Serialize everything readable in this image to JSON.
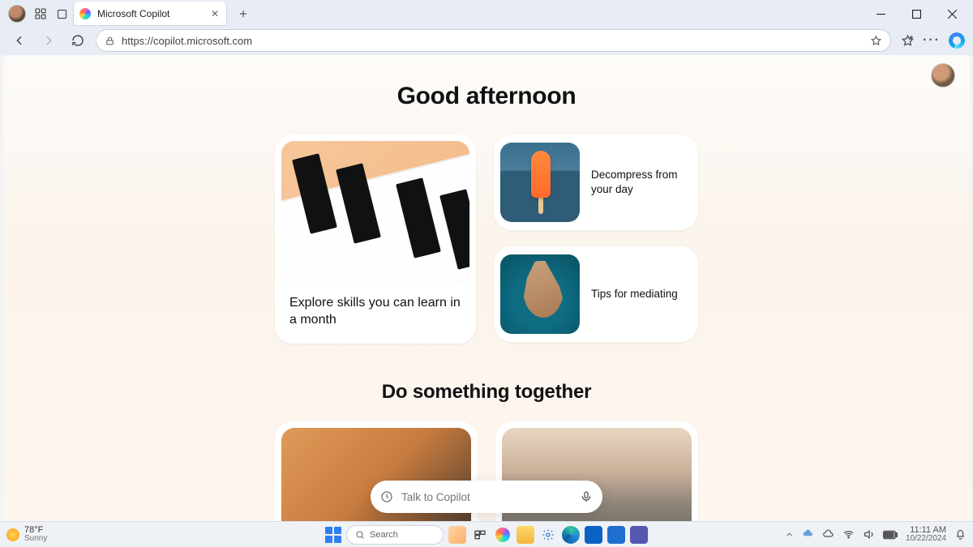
{
  "browser": {
    "tab_title": "Microsoft Copilot",
    "url": "https://copilot.microsoft.com"
  },
  "page": {
    "greeting": "Good afternoon",
    "cards": {
      "explore_skills": "Explore skills you can learn in a month",
      "decompress": "Decompress from your day",
      "mediating": "Tips for mediating"
    },
    "section2_title": "Do something together",
    "talkbar_placeholder": "Talk to Copilot"
  },
  "taskbar": {
    "weather_temp": "78°F",
    "weather_desc": "Sunny",
    "search_placeholder": "Search",
    "time": "11:11 AM",
    "date": "10/22/2024"
  }
}
